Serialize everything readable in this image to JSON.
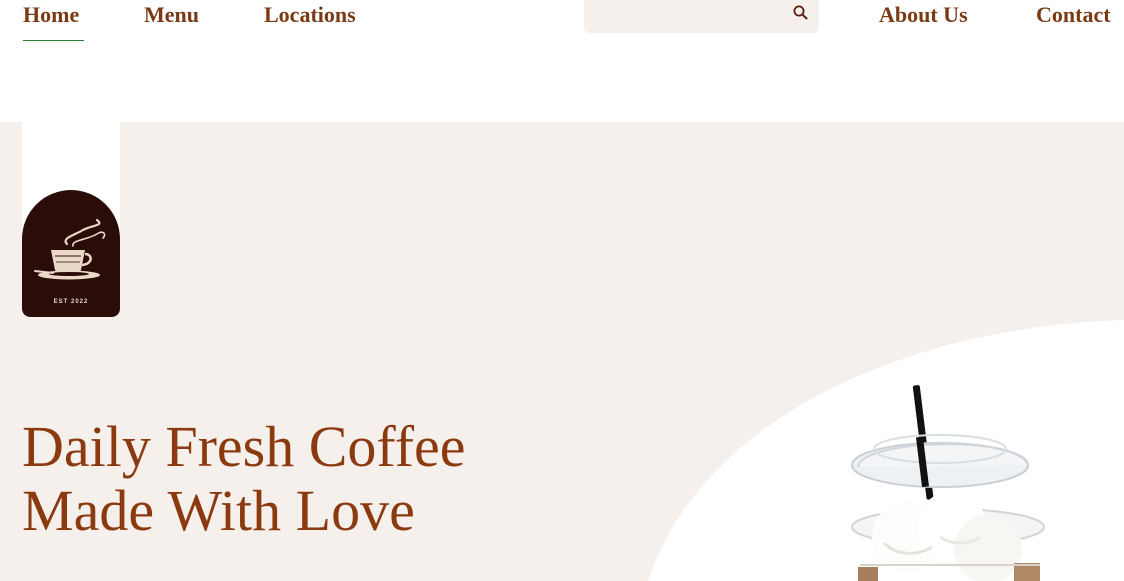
{
  "nav": {
    "home": "Home",
    "menu": "Menu",
    "locations": "Locations",
    "about": "About Us",
    "contact": "Contact",
    "active_item": "Home"
  },
  "search": {
    "placeholder": "",
    "icon": "search-icon"
  },
  "logo": {
    "est_text": "EST 2022",
    "icon": "coffee-cup-icon"
  },
  "hero": {
    "title_line1": "Daily Fresh Coffee",
    "title_line2": "Made With Love",
    "product_image": "iced-coffee-cup-image"
  },
  "colors": {
    "brand_brown": "#8b3a10",
    "nav_text": "#7a3a14",
    "hero_bg": "#f5f0ec",
    "logo_bg": "#2a0d09",
    "active_underline": "#2e7d32"
  }
}
